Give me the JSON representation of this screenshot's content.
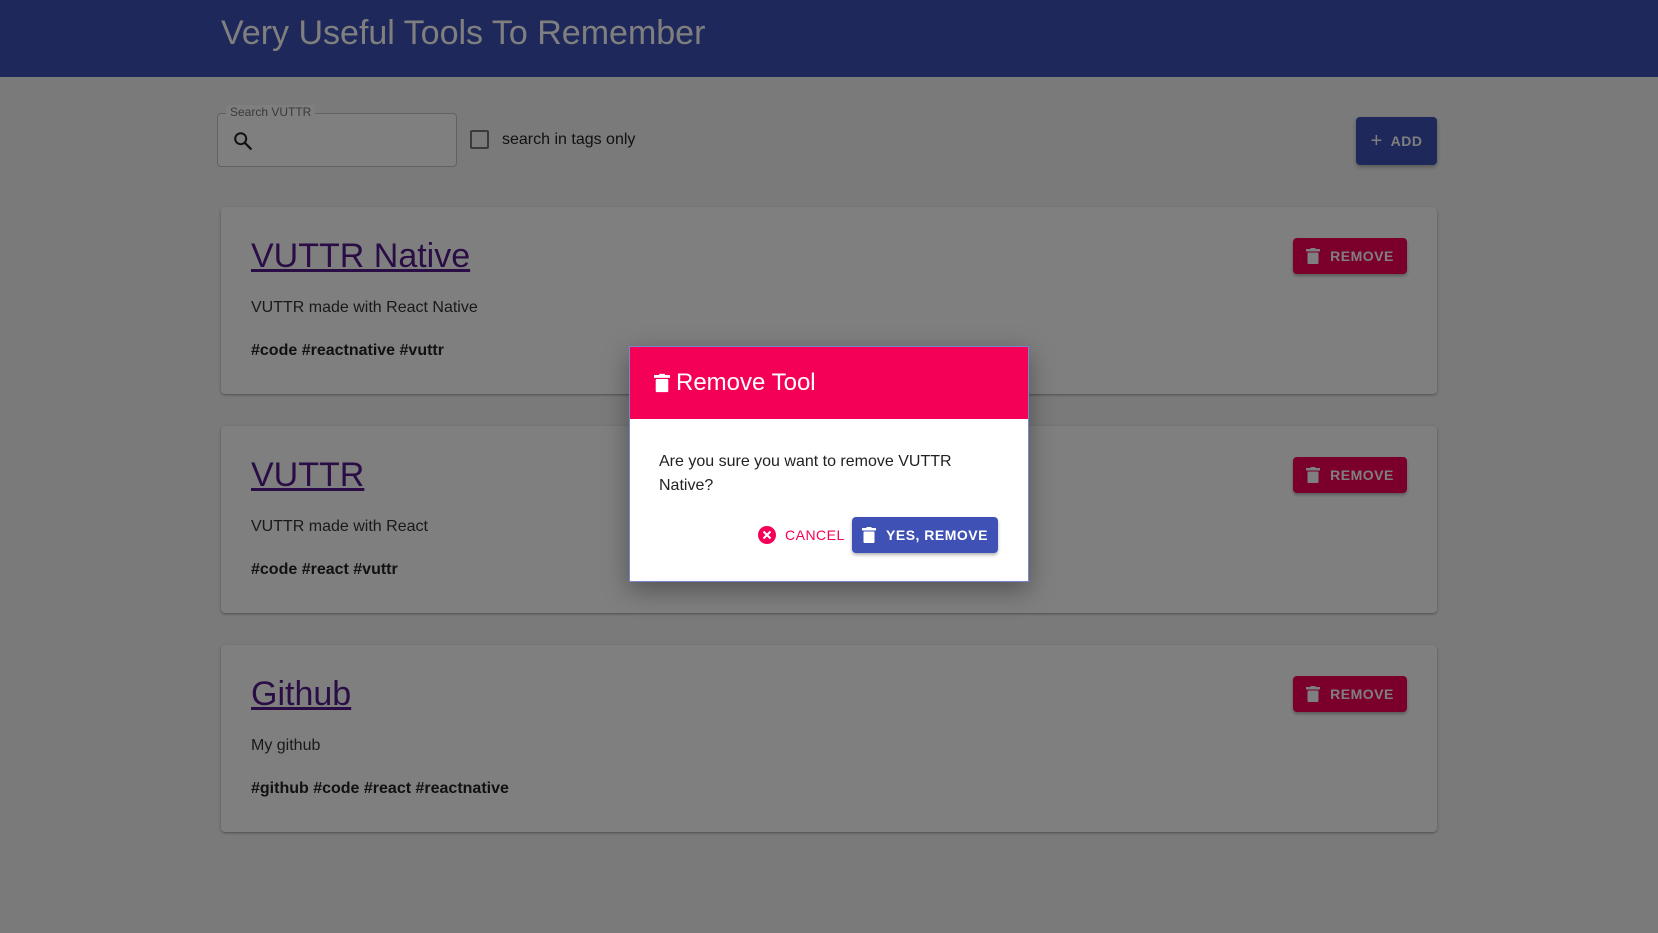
{
  "app": {
    "title": "Very Useful Tools To Remember"
  },
  "colors": {
    "primary": "#3f51b5",
    "secondary": "#f50057",
    "link": "#551a8b"
  },
  "search": {
    "label": "Search VUTTR",
    "value": "",
    "icon": "search-icon"
  },
  "filter": {
    "tags_only_label": "search in tags only",
    "checked": false
  },
  "toolbar": {
    "add_label": "ADD",
    "add_icon": "plus-icon"
  },
  "tools": [
    {
      "title": "VUTTR Native",
      "description": "VUTTR made with React Native",
      "tags": "#code #reactnative #vuttr",
      "remove_label": "REMOVE"
    },
    {
      "title": "VUTTR",
      "description": "VUTTR made with React",
      "tags": "#code #react #vuttr",
      "remove_label": "REMOVE"
    },
    {
      "title": "Github",
      "description": "My github",
      "tags": "#github #code #react #reactnative",
      "remove_label": "REMOVE"
    }
  ],
  "dialog": {
    "title": "Remove Tool",
    "message": "Are you sure you want to remove VUTTR Native?",
    "cancel_label": "CANCEL",
    "confirm_label": "YES, REMOVE"
  }
}
